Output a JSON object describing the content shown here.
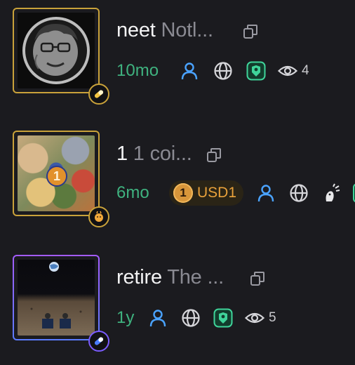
{
  "colors": {
    "background": "#1b1b1f",
    "age_green": "#3fb27f",
    "creator_blue": "#4aa3ff",
    "frame_gold": "#c9a23a",
    "frame_gradient_blue": "#5b7cff",
    "frame_gradient_purple": "#a45cff",
    "usd_orange": "#e8a13b",
    "pill_bg": "#2a2416"
  },
  "tokens": [
    {
      "name": "neet",
      "description": "Notl...",
      "age": "10mo",
      "views": "4",
      "badge_icon": "pill-icon",
      "icons": [
        "user-icon",
        "globe-icon",
        "shield-lion-icon",
        "eye-icon"
      ]
    },
    {
      "name": "1",
      "description": "1 coi...",
      "age": "6mo",
      "coin_label": "USD1",
      "coin_symbol": "1",
      "thumb_coin_symbol": "1",
      "badge_icon": "bonk-icon",
      "icons": [
        "usd1-coin-icon",
        "user-icon",
        "globe-icon",
        "bonk-icon"
      ]
    },
    {
      "name": "retire",
      "description": "The ...",
      "age": "1y",
      "views": "5",
      "badge_icon": "pill-icon",
      "icons": [
        "user-icon",
        "globe-icon",
        "shield-lion-icon",
        "eye-icon"
      ]
    }
  ]
}
